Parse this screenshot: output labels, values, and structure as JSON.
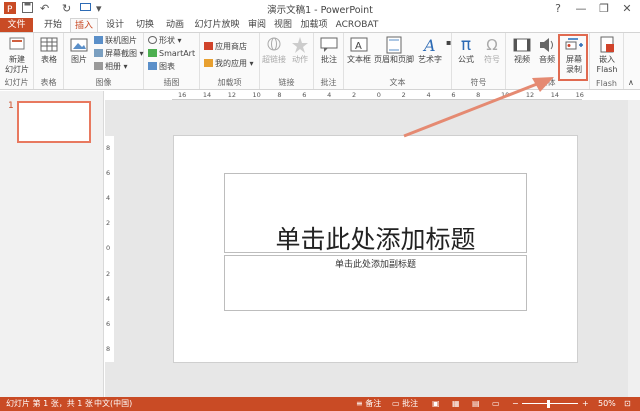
{
  "window": {
    "title": "演示文稿1 - PowerPoint",
    "help": "?",
    "minimize": "—",
    "restore": "❐",
    "close": "✕"
  },
  "tabs": [
    "文件",
    "开始",
    "插入",
    "设计",
    "切换",
    "动画",
    "幻灯片放映",
    "审阅",
    "视图",
    "加载项",
    "ACROBAT"
  ],
  "ribbon": {
    "new_slide": "新建\n幻灯片",
    "group_slides": "幻灯片",
    "table": "表格",
    "group_tables": "表格",
    "pictures": "图片",
    "online_pictures": "联机图片",
    "screenshot": "屏幕截图",
    "album": "相册",
    "group_images": "图像",
    "shapes": "形状",
    "smartart": "SmartArt",
    "chart": "图表",
    "group_illustrations": "插图",
    "store": "应用商店",
    "my_apps": "我的应用",
    "group_addins": "加载项",
    "hyperlink": "超链接",
    "action": "动作",
    "group_links": "链接",
    "comment": "批注",
    "group_comments": "批注",
    "textbox": "文本框",
    "header_footer": "页眉和页脚",
    "wordart": "艺术字",
    "group_text": "文本",
    "equation": "公式",
    "symbol": "符号",
    "group_symbols": "符号",
    "video": "视频",
    "audio": "音频",
    "screen_recording": "屏幕\n录制",
    "group_media": "媒体",
    "embed_flash": "嵌入\nFlash",
    "group_flash": "Flash"
  },
  "ruler_numbers": [
    "16",
    "14",
    "12",
    "10",
    "8",
    "6",
    "4",
    "2",
    "0",
    "2",
    "4",
    "6",
    "8",
    "10",
    "12",
    "14",
    "16"
  ],
  "vruler_numbers": [
    "8",
    "6",
    "4",
    "2",
    "0",
    "2",
    "4",
    "6",
    "8"
  ],
  "thumbnail": {
    "number": "1"
  },
  "slide": {
    "title_placeholder": "单击此处添加标题",
    "subtitle_placeholder": "单击此处添加副标题"
  },
  "status": {
    "slide_info": "幻灯片 第 1 张，共 1 张",
    "language": "中文(中国)",
    "notes": "备注",
    "comments": "批注",
    "zoom_minus": "−",
    "zoom_plus": "+",
    "zoom": "50%"
  },
  "colors": {
    "accent": "#c94b25",
    "highlight": "#e06a50"
  }
}
